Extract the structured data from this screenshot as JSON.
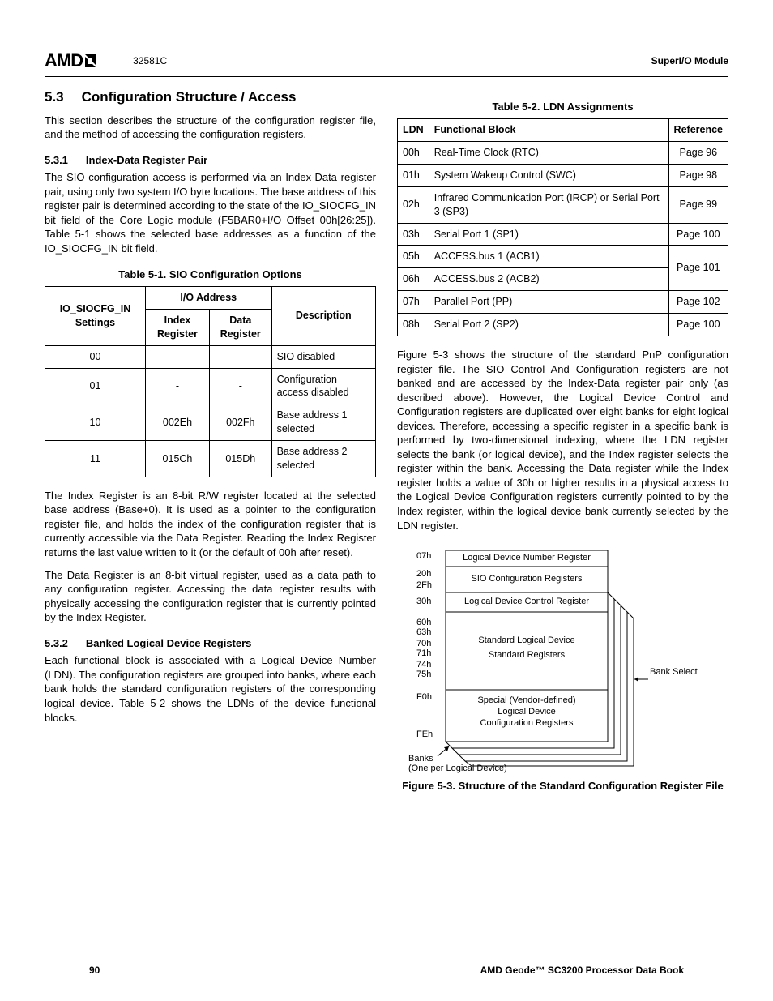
{
  "header": {
    "logo_text": "AMD",
    "docnum": "32581C",
    "docright": "SuperI/O Module"
  },
  "section": {
    "num": "5.3",
    "title": "Configuration Structure / Access",
    "intro": "This section describes the structure of the configuration register file, and the method of accessing the configuration registers."
  },
  "sub1": {
    "num": "5.3.1",
    "title": "Index-Data Register Pair",
    "p1": "The SIO configuration access is performed via an Index-Data register pair, using only two system I/O byte locations. The base address of this register pair is determined according to the state of the IO_SIOCFG_IN bit field of the Core Logic module (F5BAR0+I/O Offset 00h[26:25]). Table 5-1 shows the selected base addresses as a function of the IO_SIOCFG_IN bit field."
  },
  "table1": {
    "caption": "Table 5-1.  SIO Configuration Options",
    "h_io": "I/O Address",
    "h_settings": "IO_SIOCFG_IN Settings",
    "h_index": "Index Register",
    "h_data": "Data Register",
    "h_desc": "Description",
    "rows": [
      {
        "s": "00",
        "i": "-",
        "d": "-",
        "desc": "SIO disabled"
      },
      {
        "s": "01",
        "i": "-",
        "d": "-",
        "desc": "Configuration access disabled"
      },
      {
        "s": "10",
        "i": "002Eh",
        "d": "002Fh",
        "desc": "Base address 1 selected"
      },
      {
        "s": "11",
        "i": "015Ch",
        "d": "015Dh",
        "desc": "Base address 2 selected"
      }
    ]
  },
  "sub1p2": "The Index Register is an 8-bit R/W register located at the selected base address (Base+0). It is used as a pointer to the configuration register file, and holds the index of the configuration register that is currently accessible via the Data Register. Reading the Index Register returns the last value written to it (or the default of 00h after reset).",
  "sub1p3": "The Data Register is an 8-bit virtual register, used as a data path to any configuration register. Accessing the data register results with physically accessing the configuration register that is currently pointed by the Index Register.",
  "sub2": {
    "num": "5.3.2",
    "title": "Banked Logical Device Registers",
    "p1": "Each functional block is associated with a Logical Device Number (LDN). The configuration registers are grouped into banks, where each bank holds the standard configuration registers of the corresponding logical device. Table 5-2 shows the LDNs of the device functional blocks."
  },
  "table2": {
    "caption": "Table 5-2.  LDN Assignments",
    "h_ldn": "LDN",
    "h_fb": "Functional Block",
    "h_ref": "Reference",
    "rows": [
      {
        "l": "00h",
        "fb": "Real-Time Clock (RTC)",
        "r": "Page 96"
      },
      {
        "l": "01h",
        "fb": "System Wakeup Control (SWC)",
        "r": "Page 98"
      },
      {
        "l": "02h",
        "fb": "Infrared Communication Port (IRCP) or Serial Port 3 (SP3)",
        "r": "Page 99"
      },
      {
        "l": "03h",
        "fb": "Serial Port 1 (SP1)",
        "r": "Page 100"
      },
      {
        "l": "05h",
        "fb": "ACCESS.bus 1 (ACB1)",
        "r": "Page 101"
      },
      {
        "l": "06h",
        "fb": "ACCESS.bus 2 (ACB2)",
        "r": ""
      },
      {
        "l": "07h",
        "fb": "Parallel Port (PP)",
        "r": "Page 102"
      },
      {
        "l": "08h",
        "fb": "Serial Port 2 (SP2)",
        "r": "Page 100"
      }
    ]
  },
  "rightp1": "Figure 5-3 shows the structure of the standard PnP configuration register file. The SIO Control And Configuration registers are not banked and are accessed by the Index-Data register pair only (as described above). However, the Logical Device Control and Configuration registers are duplicated over eight banks for eight logical devices. Therefore, accessing a specific register in a specific bank is performed by two-dimensional indexing, where the LDN register selects the bank (or logical device), and the Index register selects the register within the bank. Accessing the Data register while the Index register holds a value of 30h or higher results in a physical access to the Logical Device Configuration registers currently pointed to by the Index register, within the logical device bank currently selected by the LDN register.",
  "figure": {
    "a07": "07h",
    "a20": "20h",
    "a2f": "2Fh",
    "a30": "30h",
    "a60": "60h",
    "a63": "63h",
    "a70": "70h",
    "a71": "71h",
    "a74": "74h",
    "a75": "75h",
    "af0": "F0h",
    "afe": "FEh",
    "l1": "Logical Device Number Register",
    "l2": "SIO Configuration Registers",
    "l3": "Logical Device Control Register",
    "l4a": "Standard Logical Device",
    "l4b": "Standard Registers",
    "l5a": "Special (Vendor-defined)",
    "l5b": "Logical Device",
    "l5c": "Configuration Registers",
    "bank": "Bank Select",
    "banks": "Banks",
    "onep": "(One per Logical Device)",
    "caption": "Figure 5-3.  Structure of the Standard Configuration Register File"
  },
  "footer": {
    "page": "90",
    "book": "AMD Geode™ SC3200 Processor Data Book"
  }
}
